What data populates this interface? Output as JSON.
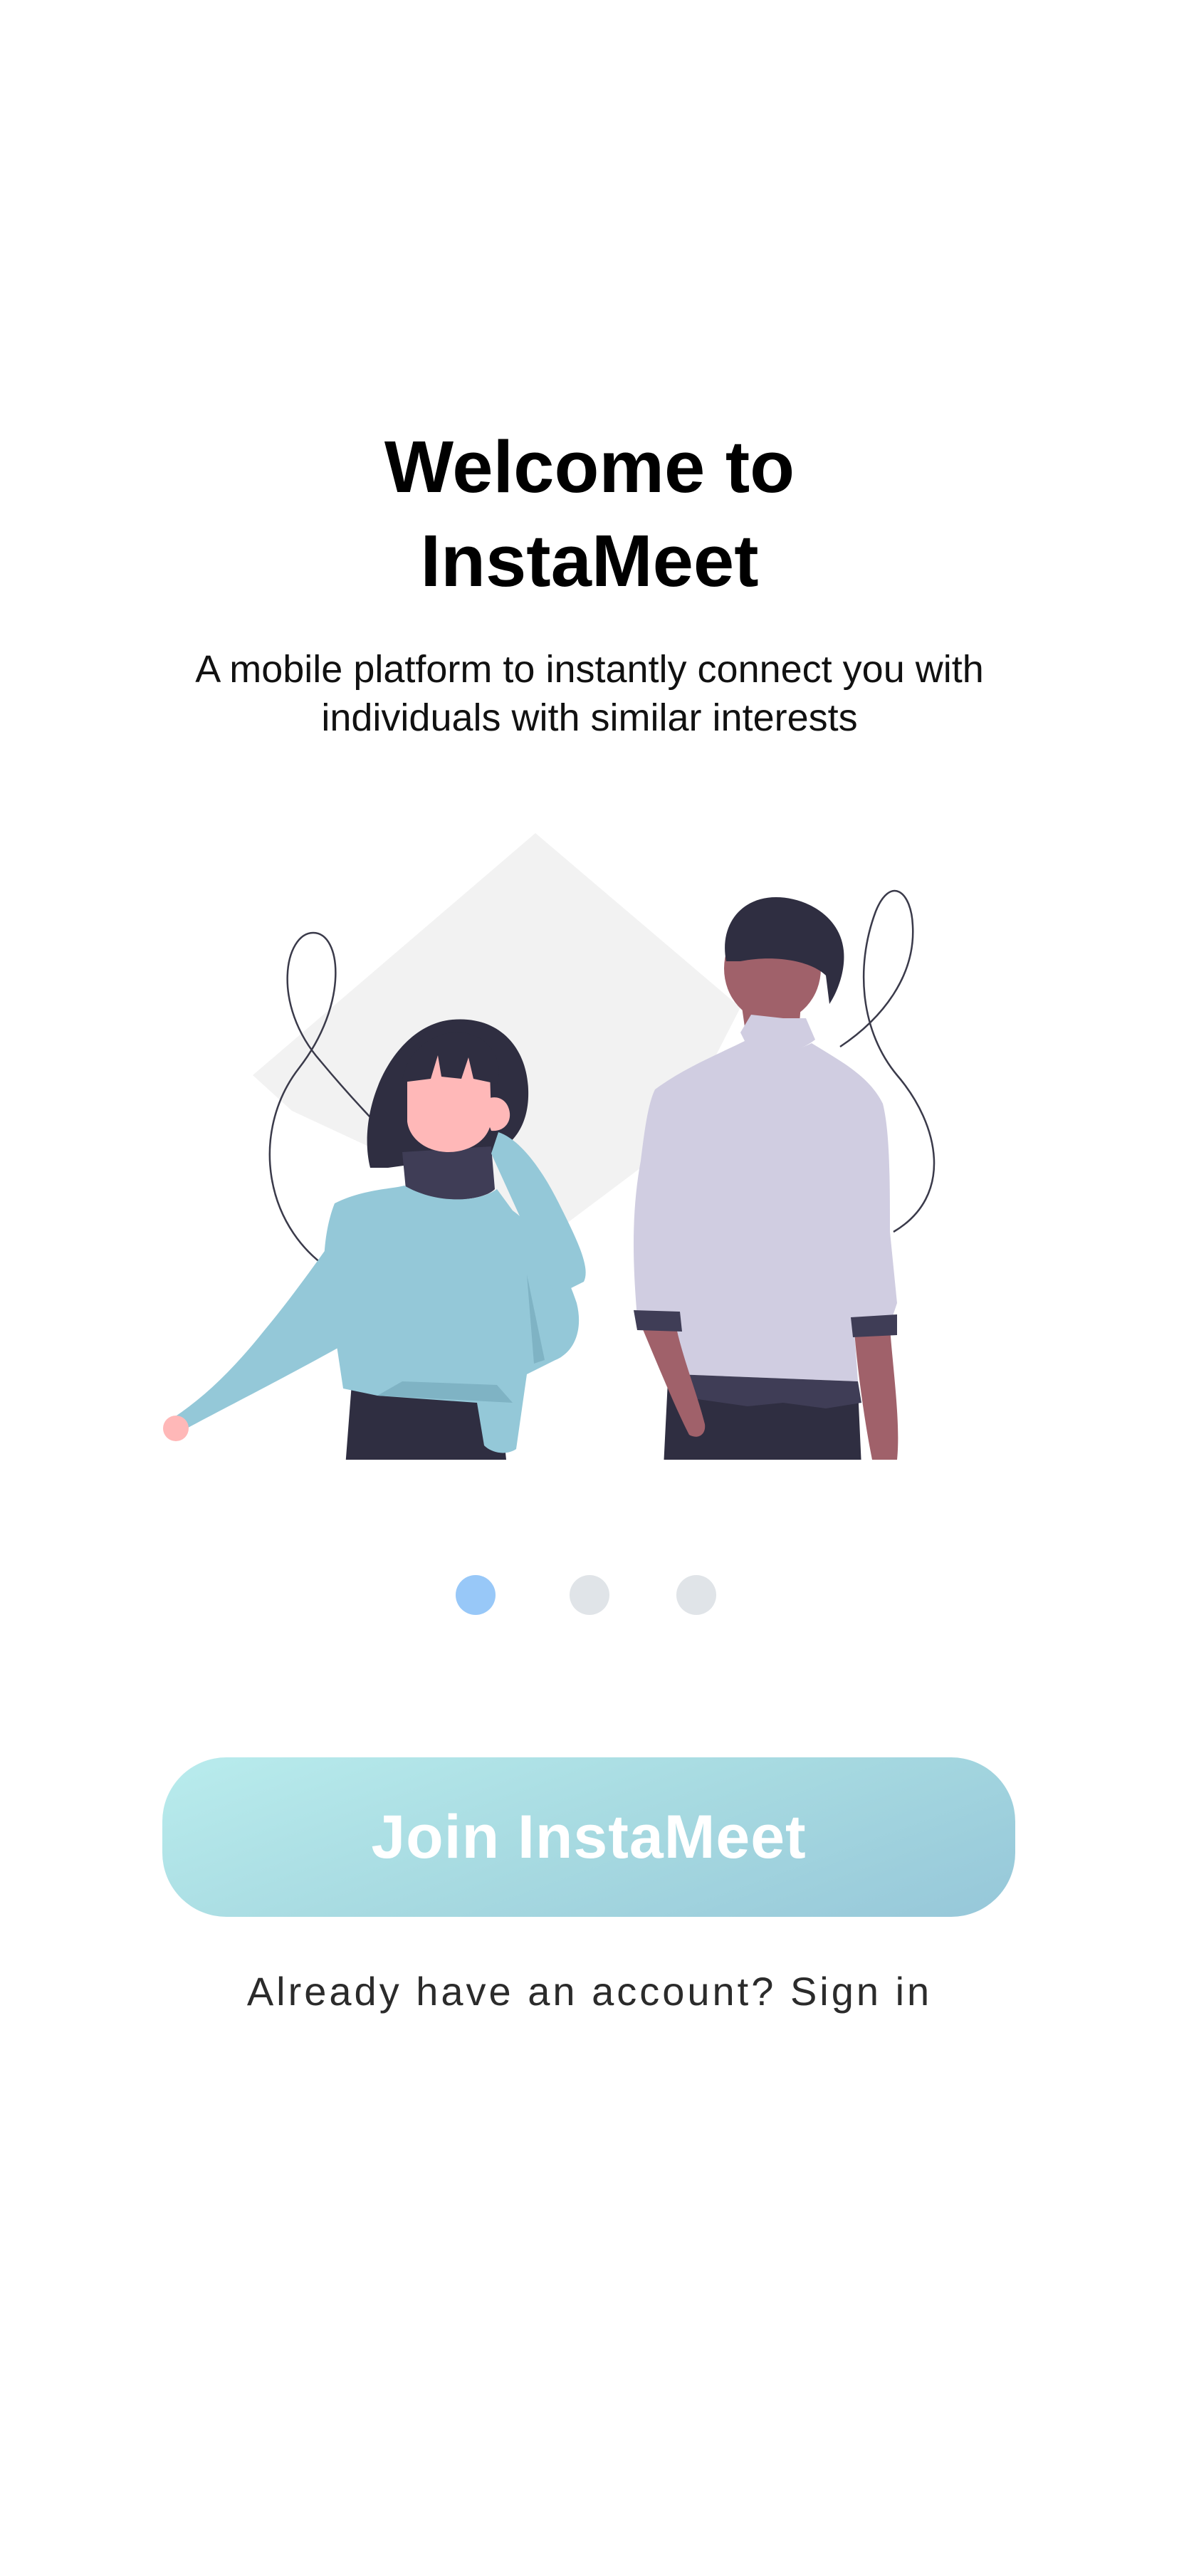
{
  "onboarding": {
    "title_line1": "Welcome to",
    "title_line2": "InstaMeet",
    "subtitle": "A mobile platform to instantly connect you with individuals with similar interests",
    "illustration_icon": "two-people-illustration",
    "pager": {
      "total_pages": 3,
      "current_page": 1
    },
    "primary_button_label": "Join InstaMeet",
    "signin_prompt": "Already have an account?",
    "signin_link_label": "Sign in"
  },
  "colors": {
    "background": "#ffffff",
    "title": "#000000",
    "active_dot": "#98c8f8",
    "inactive_dot": "#e0e4e8",
    "button_gradient_start": "#b9eced",
    "button_gradient_end": "#96c7d9",
    "button_text": "#ffffff"
  }
}
